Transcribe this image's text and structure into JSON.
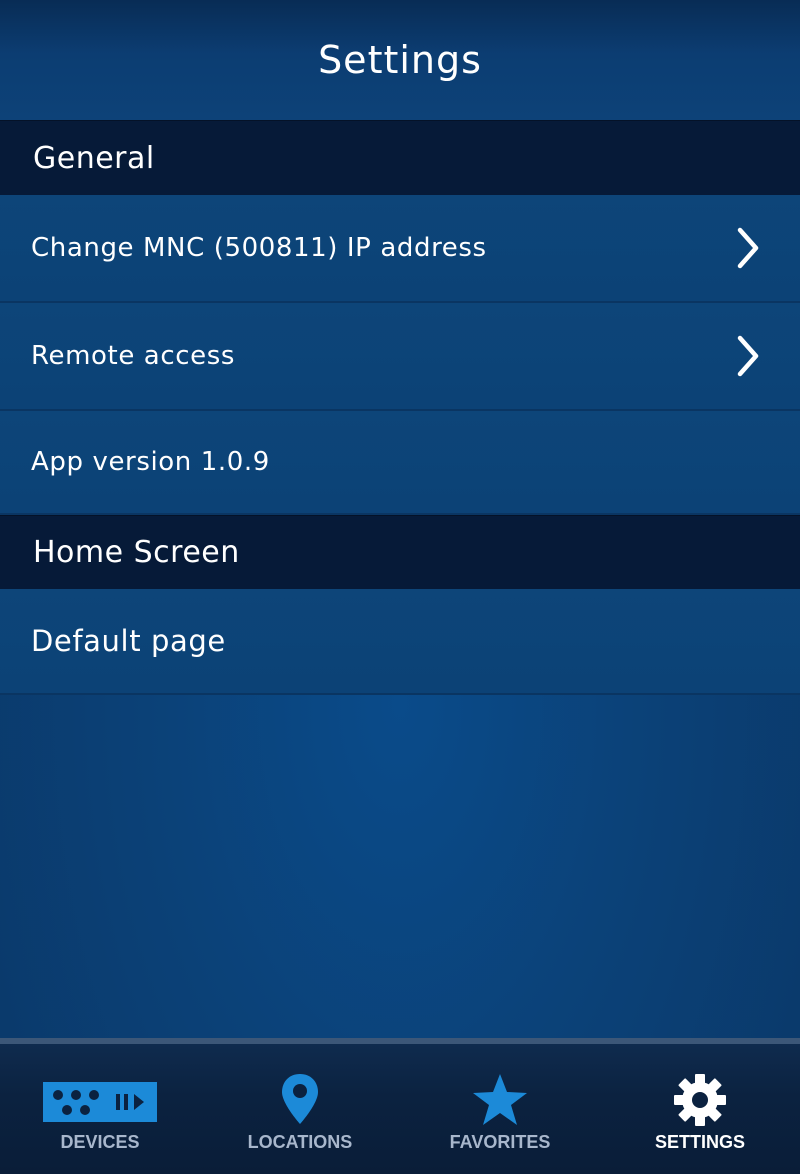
{
  "header": {
    "title": "Settings"
  },
  "sections": [
    {
      "title": "General",
      "rows": [
        {
          "label": "Change MNC (500811) IP address",
          "chevron": true
        },
        {
          "label": "Remote access",
          "chevron": true
        },
        {
          "label": "App version 1.0.9",
          "chevron": false
        }
      ]
    },
    {
      "title": "Home Screen",
      "rows": [
        {
          "label": "Default page",
          "chevron": false
        }
      ]
    }
  ],
  "tabbar": {
    "tabs": [
      {
        "label": "DEVICES",
        "icon": "devices-icon",
        "active": false
      },
      {
        "label": "LOCATIONS",
        "icon": "location-pin-icon",
        "active": false
      },
      {
        "label": "FAVORITES",
        "icon": "star-icon",
        "active": false
      },
      {
        "label": "SETTINGS",
        "icon": "gear-icon",
        "active": true
      }
    ]
  },
  "colors": {
    "accent": "#1c8ad8",
    "header_bar": "#0c3d72",
    "section_header": "#061a38",
    "tab_label_inactive": "#a8b7cc",
    "tab_label_active": "#ffffff"
  }
}
